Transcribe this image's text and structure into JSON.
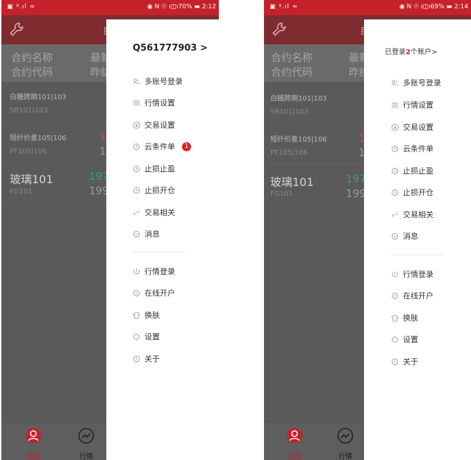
{
  "left": {
    "status": {
      "left": "▣ ᵍ.ıl ≈",
      "right": "◉ N ☉ ı◫ı70% ▬ 2:12"
    },
    "account_label": "Q561777903 >",
    "header_partial": "自",
    "columns": {
      "name": "合约名称",
      "code": "合约代码",
      "latest": "最新",
      "prev": "昨结"
    },
    "rows": [
      {
        "name": "白糖跨期101|103",
        "code": "SR101|103",
        "v1": "",
        "v2": ""
      },
      {
        "name": "短纤价差105|106",
        "code": "PF105|106",
        "v1": "1",
        "v2": "1"
      },
      {
        "name": "玻璃101",
        "code": "FG101",
        "v1": "197",
        "v2": "199"
      }
    ],
    "menu_group1": [
      "多账号登录",
      "行情设置",
      "交易设置",
      "云条件单",
      "止损止盈",
      "止损开仓",
      "交易相关",
      "消息"
    ],
    "badge_count": "1",
    "menu_group2": [
      "行情登录",
      "在线开户",
      "换肤",
      "设置",
      "关于"
    ],
    "tabs": [
      {
        "label": "自选"
      },
      {
        "label": "行情"
      }
    ]
  },
  "right": {
    "status": {
      "left": "▣ ᵍ.ıl ≈",
      "right": "◉ N ☉ ı◫ı69% ▬ 2:14"
    },
    "account_prefix": "已登录",
    "account_count": "2",
    "account_suffix": "个账户>",
    "header_partial": "自",
    "columns": {
      "name": "合约名称",
      "code": "合约代码",
      "latest": "最新",
      "prev": "昨结"
    },
    "rows": [
      {
        "name": "白糖跨期101|103",
        "code": "SR101|103",
        "v1": "",
        "v2": ""
      },
      {
        "name": "短纤价差105|106",
        "code": "PF105|106",
        "v1": "1",
        "v2": "1"
      },
      {
        "name": "玻璃101",
        "code": "FG101",
        "v1": "197",
        "v2": "199"
      }
    ],
    "menu_group1": [
      "多账号登录",
      "行情设置",
      "交易设置",
      "云条件单",
      "止损止盈",
      "止损开仓",
      "交易相关",
      "消息"
    ],
    "menu_group2": [
      "行情登录",
      "在线开户",
      "换肤",
      "设置",
      "关于"
    ],
    "tabs": [
      {
        "label": "自选"
      },
      {
        "label": "行情"
      }
    ]
  },
  "colors": {
    "brand_red": "#c5212b",
    "green_value": "#3aa36a",
    "red_value": "#c84a4a"
  }
}
